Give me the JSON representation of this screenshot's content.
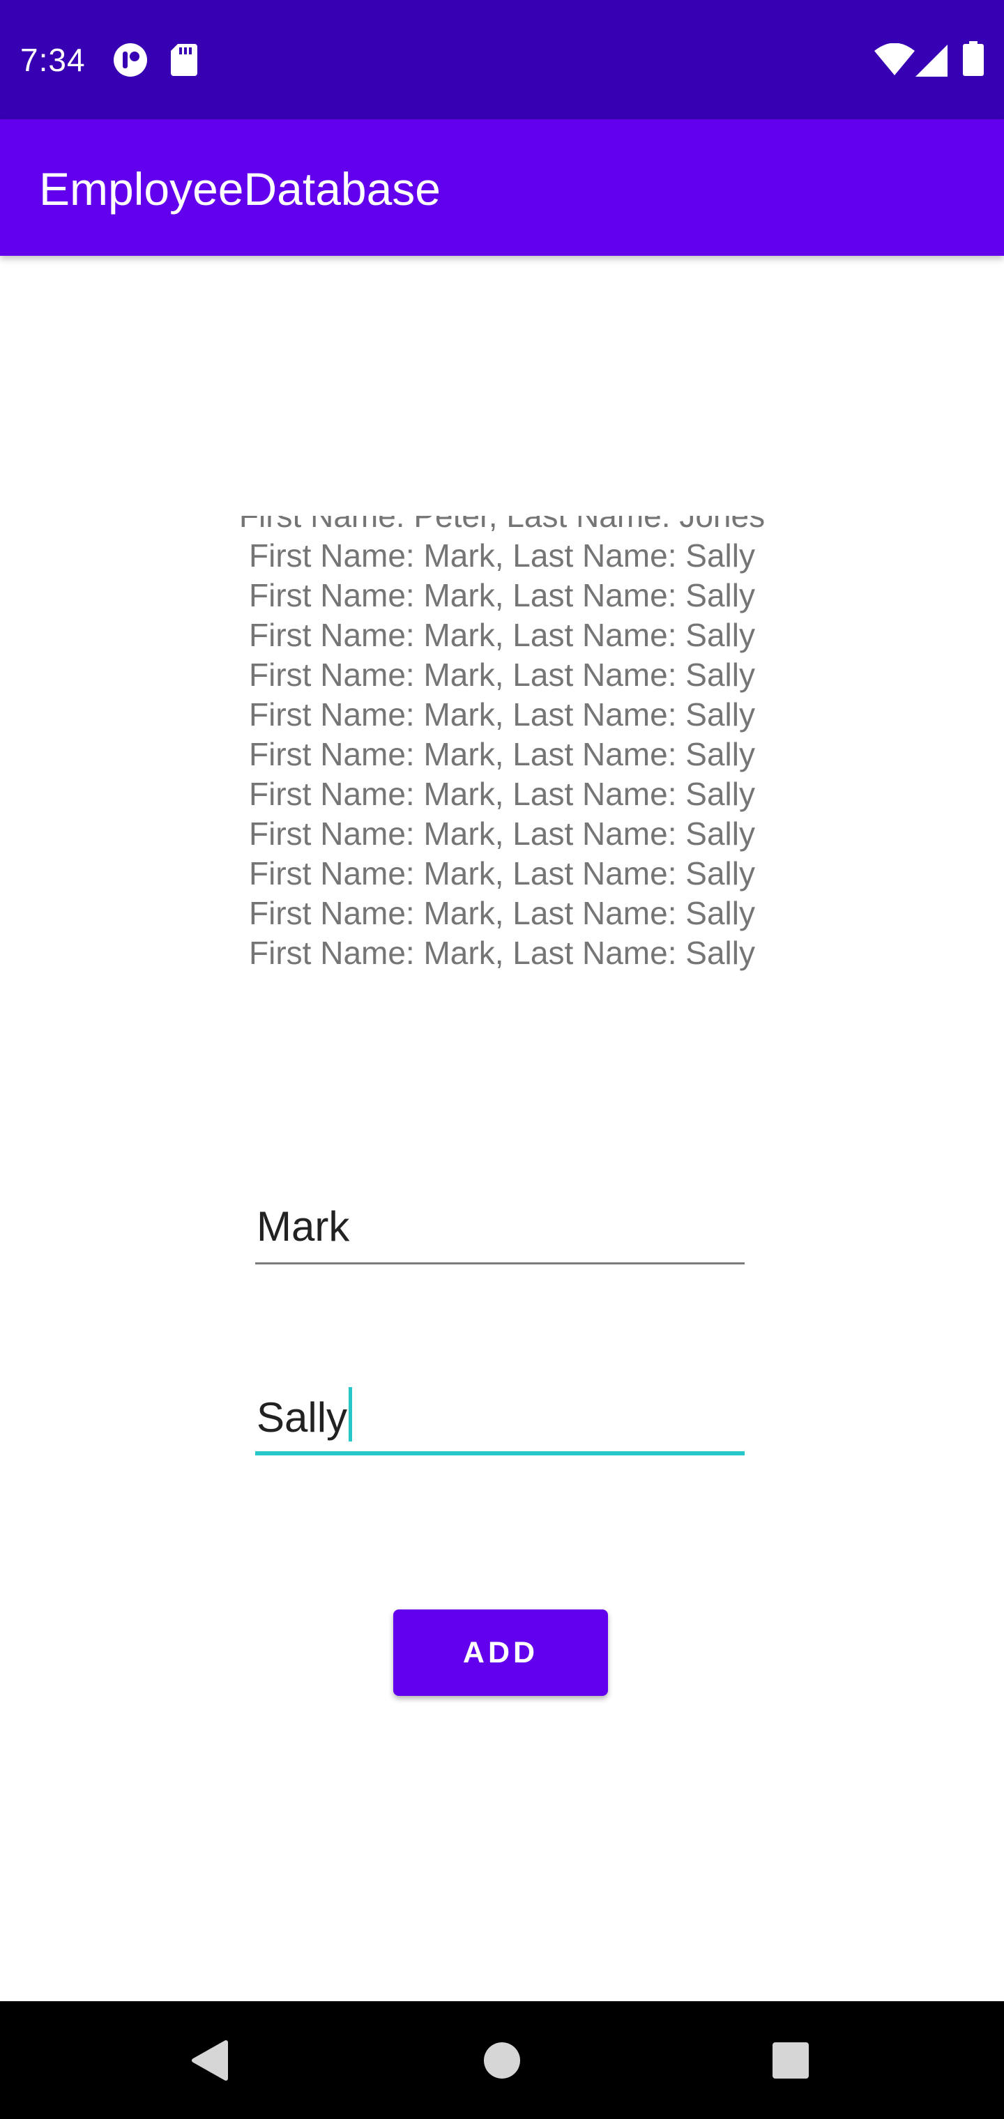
{
  "status_bar": {
    "time": "7:34",
    "icons": [
      "notification-app-icon",
      "sd-card-icon",
      "wifi-icon",
      "cellular-signal-icon",
      "battery-icon"
    ]
  },
  "app_bar": {
    "title": "EmployeeDatabase"
  },
  "employee_list": {
    "partial_top_row": "First Name: Peter, Last Name: Jones",
    "rows": [
      "First Name: Mark, Last Name: Sally",
      "First Name: Mark, Last Name: Sally",
      "First Name: Mark, Last Name: Sally",
      "First Name: Mark, Last Name: Sally",
      "First Name: Mark, Last Name: Sally",
      "First Name: Mark, Last Name: Sally",
      "First Name: Mark, Last Name: Sally",
      "First Name: Mark, Last Name: Sally",
      "First Name: Mark, Last Name: Sally",
      "First Name: Mark, Last Name: Sally",
      "First Name: Mark, Last Name: Sally"
    ]
  },
  "form": {
    "first_name_value": "Mark",
    "last_name_value": "Sally",
    "add_button_label": "ADD"
  },
  "nav_bar": {
    "buttons": [
      "back-icon",
      "home-icon",
      "recents-icon"
    ]
  },
  "colors": {
    "status_bar": "#3700b3",
    "primary": "#6200ee",
    "focus_accent": "#26c6c9",
    "list_text": "#757575"
  }
}
